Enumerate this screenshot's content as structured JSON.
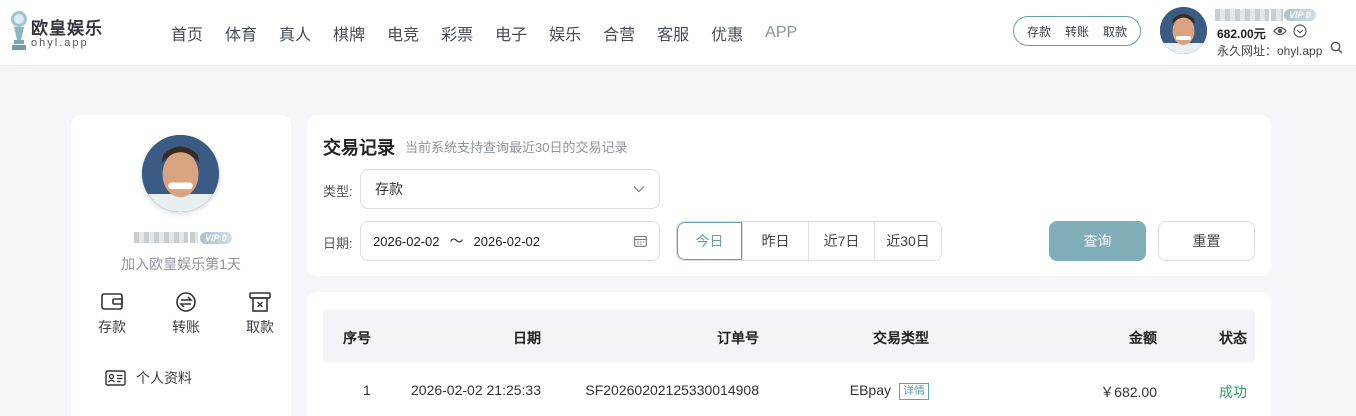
{
  "brand": {
    "name": "欧皇娱乐",
    "domain": "ohyl.app"
  },
  "nav": [
    "首页",
    "体育",
    "真人",
    "棋牌",
    "电竞",
    "彩票",
    "电子",
    "娱乐",
    "合营",
    "客服",
    "优惠",
    "APP"
  ],
  "quick_actions": [
    "存款",
    "转账",
    "取款"
  ],
  "user": {
    "vip": "VIP 0",
    "balance": "682.00元",
    "site_url": "永久网址：ohyl.app"
  },
  "sidebar": {
    "vip": "VIP 0",
    "join_text": "加入欧皇娱乐第1天",
    "actions": [
      {
        "label": "存款",
        "icon": "wallet-icon"
      },
      {
        "label": "转账",
        "icon": "transfer-icon"
      },
      {
        "label": "取款",
        "icon": "withdraw-icon"
      }
    ],
    "profile": {
      "label": "个人资料",
      "icon": "id-card-icon"
    }
  },
  "filter": {
    "title": "交易记录",
    "subtitle": "当前系统支持查询最近30日的交易记录",
    "type_label": "类型:",
    "type_value": "存款",
    "date_label": "日期:",
    "date_start": "2026-02-02",
    "date_sep": "〜",
    "date_end": "2026-02-02",
    "quick_ranges": [
      "今日",
      "昨日",
      "近7日",
      "近30日"
    ],
    "active_range": "今日",
    "query_label": "查询",
    "reset_label": "重置"
  },
  "table": {
    "columns": [
      "序号",
      "日期",
      "订单号",
      "交易类型",
      "金额",
      "状态"
    ],
    "rows": [
      {
        "index": "1",
        "date": "2026-02-02 21:25:33",
        "order_no": "SF20260202125330014908",
        "type": "EBpay",
        "detail": "详情",
        "amount": "￥682.00",
        "status": "成功"
      }
    ]
  },
  "colors": {
    "accent": "#6a9ea9",
    "query_button": "#7fadb8",
    "success": "#2fa05f",
    "page_bg": "#f4f6fa"
  }
}
